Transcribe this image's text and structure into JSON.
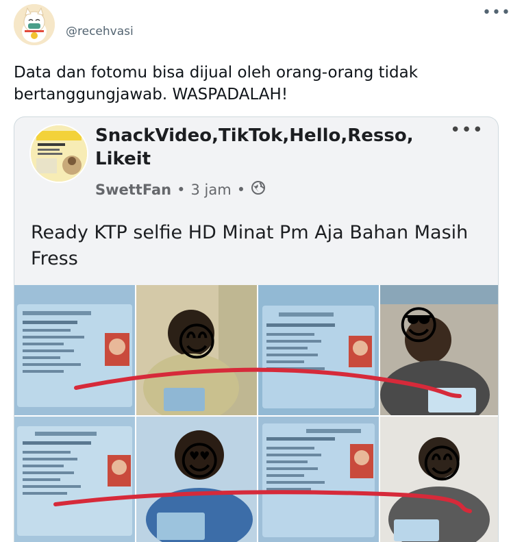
{
  "tweet": {
    "handle": "@recehvasi",
    "more_icon": "more-icon",
    "text": "Data dan fotomu bisa dijual oleh orang-orang tidak bertanggungjawab. WASPADALAH!"
  },
  "embedded_post": {
    "title": "SnackVideo,TikTok,Hello,Resso,Likeit",
    "author": "SwettFan",
    "time": "3 jam",
    "separator": "•",
    "privacy_icon": "globe-icon",
    "more_icon": "more-icon",
    "text": "Ready KTP selfie HD Minat Pm Aja Bahan Masih Fress"
  },
  "colors": {
    "muted": "#536471",
    "card_bg": "#f2f3f5",
    "red_marker": "#d62a3a",
    "id_card_blue": "#7fb0d6"
  }
}
